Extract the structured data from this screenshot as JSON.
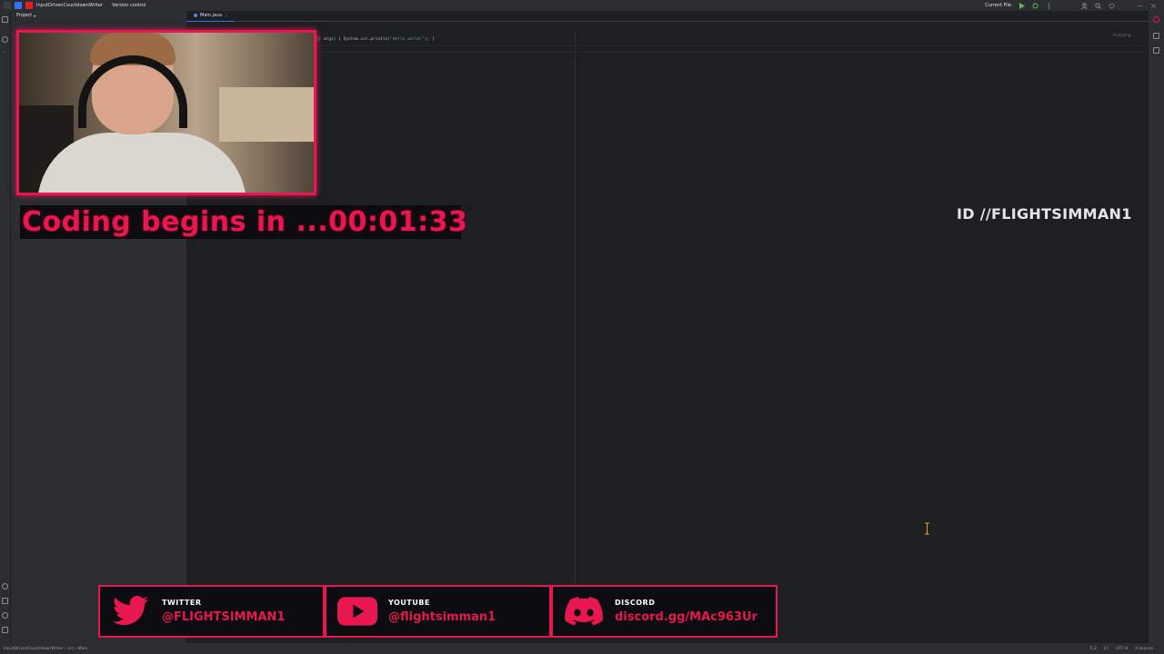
{
  "titlebar": {
    "project": "InputDrivenCountdownWriter",
    "version_control": "Version control",
    "run_config": "Current File"
  },
  "project_panel": {
    "title": "Project"
  },
  "editor": {
    "tab": "Main.java",
    "code_prefix": "g[] args) { System.",
    "code_field": "out",
    "code_mid": ".println(",
    "code_string": "\"Hello world!\"",
    "code_suffix": "); }",
    "status_hint": "Analyzing..."
  },
  "statusbar": {
    "path": "InputDrivenCountdownWriter  ›  src  ›  Main",
    "position": "5:2",
    "line_ending": "LF",
    "encoding": "UTF-8",
    "indent": "4 spaces"
  },
  "overlay": {
    "countdown": "Coding begins in ...00:01:33",
    "id_tag": "ID //FLIGHTSIMMAN1",
    "socials": [
      {
        "title": "TWITTER",
        "handle": "@FLIGHTSIMMAN1",
        "icon": "twitter-bird-icon"
      },
      {
        "title": "YOUTUBE",
        "handle": "@flightsimman1",
        "icon": "youtube-play-icon"
      },
      {
        "title": "DISCORD",
        "handle": "discord.gg/MAc963Ur",
        "icon": "discord-icon"
      }
    ]
  },
  "colors": {
    "accent": "#e8174f",
    "ide_bg": "#1e1f22",
    "panel_bg": "#2b2d30"
  }
}
